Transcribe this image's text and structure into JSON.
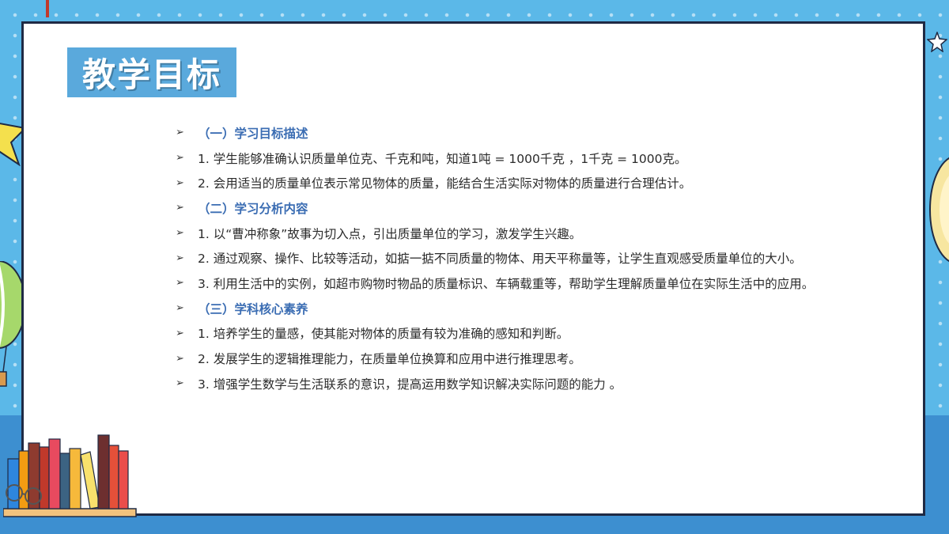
{
  "slide": {
    "title": "教学目标"
  },
  "objectives": [
    {
      "type": "heading",
      "text": "（一）学习目标描述"
    },
    {
      "type": "item",
      "text": "1. 学生能够准确认识质量单位克、千克和吨，知道1吨 = 1000千克 ，1千克 = 1000克。"
    },
    {
      "type": "item",
      "text": "2. 会用适当的质量单位表示常见物体的质量，能结合生活实际对物体的质量进行合理估计。"
    },
    {
      "type": "heading",
      "text": "（二）学习分析内容"
    },
    {
      "type": "item",
      "text": "1. 以“曹冲称象”故事为切入点，引出质量单位的学习，激发学生兴趣。"
    },
    {
      "type": "item",
      "text": "2. 通过观察、操作、比较等活动，如掂一掂不同质量的物体、用天平称量等，让学生直观感受质量单位的大小。"
    },
    {
      "type": "item",
      "text": "3. 利用生活中的实例，如超市购物时物品的质量标识、车辆载重等，帮助学生理解质量单位在实际生活中的应用。"
    },
    {
      "type": "heading",
      "text": "（三）学科核心素养"
    },
    {
      "type": "item",
      "text": "1. 培养学生的量感，使其能对物体的质量有较为准确的感知和判断。"
    },
    {
      "type": "item",
      "text": "2. 发展学生的逻辑推理能力，在质量单位换算和应用中进行推理思考。"
    },
    {
      "type": "item",
      "text": "3. 增强学生数学与生活联系的意识，提高运用数学知识解决实际问题的能力 。"
    }
  ],
  "bullet_glyph": "➢",
  "colors": {
    "background": "#5bb8e8",
    "title_box": "#5aa9dc",
    "heading_text": "#3b6db3",
    "body_text": "#2b2b2b",
    "card_border": "#1f2a44"
  },
  "icons": {
    "bullet": "arrow-bullet-icon",
    "books": "books-illustration-icon"
  }
}
